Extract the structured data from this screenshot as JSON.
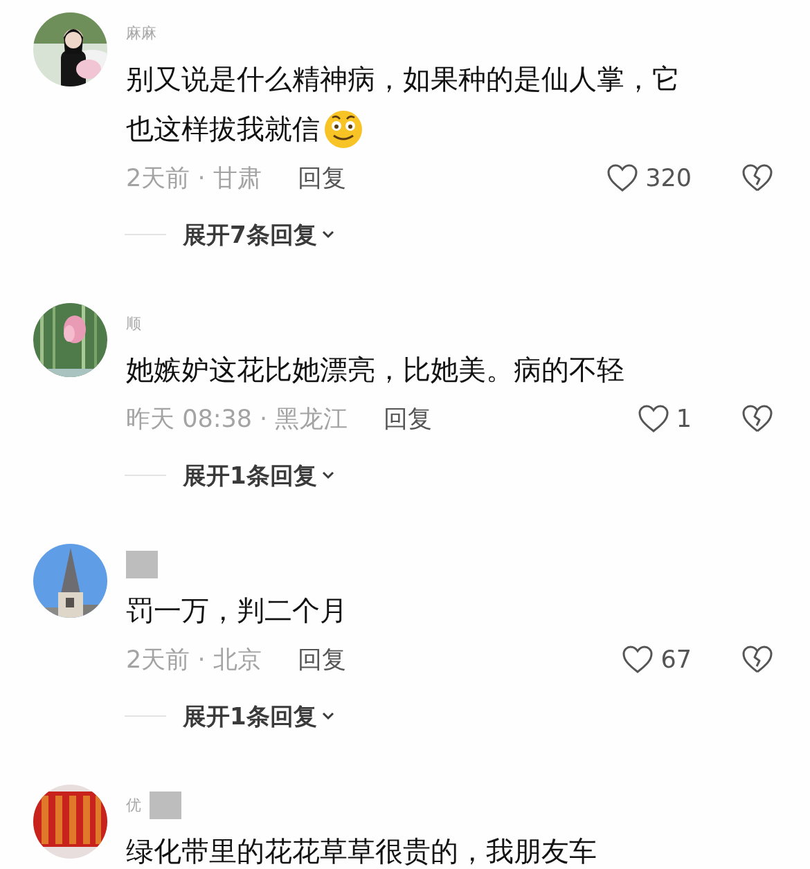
{
  "comments": [
    {
      "username": "麻麻",
      "name_redacted": false,
      "avatar": {
        "kind": "picture"
      },
      "text_lines": [
        "别又说是什么精神病，如果种的是仙人掌，它",
        "也这样拔我就信"
      ],
      "trailing_emoji": true,
      "meta": "2天前 · 甘肃",
      "reply_label": "回复",
      "likes": "320",
      "expand_label": "展开7条回复"
    },
    {
      "username": "顺",
      "name_redacted": false,
      "avatar": {
        "kind": "picture"
      },
      "text_lines": [
        "她嫉妒这花比她漂亮，比她美。病的不轻"
      ],
      "trailing_emoji": false,
      "meta": "昨天 08:38 · 黑龙江",
      "reply_label": "回复",
      "likes": "1",
      "expand_label": "展开1条回复"
    },
    {
      "name_redacted": true,
      "avatar": {
        "kind": "picture"
      },
      "text_lines": [
        "罚一万，判二个月"
      ],
      "trailing_emoji": false,
      "meta": "2天前 · 北京",
      "reply_label": "回复",
      "likes": "67",
      "expand_label": "展开1条回复"
    },
    {
      "username": "优",
      "name_redacted": true,
      "avatar": {
        "kind": "picture"
      },
      "text_lines": [
        "绿化带里的花花草草很贵的，我朋友车"
      ],
      "trailing_emoji": false
    }
  ]
}
